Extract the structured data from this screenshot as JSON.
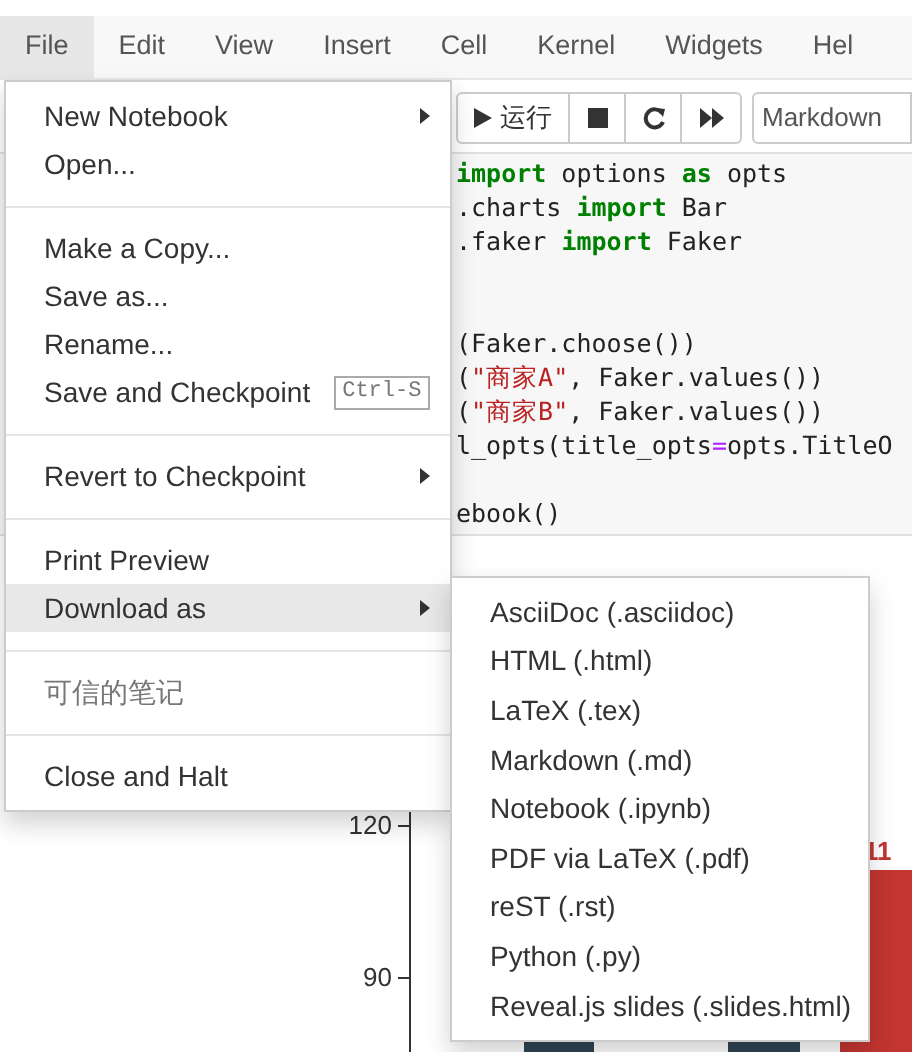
{
  "menu_bar": [
    {
      "label": "File",
      "selected": true
    },
    {
      "label": "Edit",
      "selected": false
    },
    {
      "label": "View",
      "selected": false
    },
    {
      "label": "Insert",
      "selected": false
    },
    {
      "label": "Cell",
      "selected": false
    },
    {
      "label": "Kernel",
      "selected": false
    },
    {
      "label": "Widgets",
      "selected": false
    },
    {
      "label": "Hel",
      "selected": false
    }
  ],
  "toolbar": {
    "run_label": "运行",
    "cell_type": "Markdown"
  },
  "code_lines": [
    [
      {
        "kind": "kw",
        "text": "import"
      },
      {
        "kind": "plain",
        "text": " options "
      },
      {
        "kind": "kw",
        "text": "as"
      },
      {
        "kind": "plain",
        "text": " opts"
      }
    ],
    [
      {
        "kind": "plain",
        "text": ".charts "
      },
      {
        "kind": "kw",
        "text": "import"
      },
      {
        "kind": "plain",
        "text": " Bar"
      }
    ],
    [
      {
        "kind": "plain",
        "text": ".faker "
      },
      {
        "kind": "kw",
        "text": "import"
      },
      {
        "kind": "plain",
        "text": " Faker"
      }
    ],
    [
      {
        "kind": "plain",
        "text": "(Faker.choose())"
      }
    ],
    [
      {
        "kind": "plain",
        "text": "("
      },
      {
        "kind": "str",
        "text": "\"商家A\""
      },
      {
        "kind": "plain",
        "text": ", Faker.values())"
      }
    ],
    [
      {
        "kind": "plain",
        "text": "("
      },
      {
        "kind": "str",
        "text": "\"商家B\""
      },
      {
        "kind": "plain",
        "text": ", Faker.values())"
      }
    ],
    [
      {
        "kind": "plain",
        "text": "l_opts(title_opts"
      },
      {
        "kind": "op",
        "text": "="
      },
      {
        "kind": "plain",
        "text": "opts.TitleO"
      }
    ],
    [
      {
        "kind": "plain",
        "text": "ebook()"
      }
    ]
  ],
  "chart": {
    "yticks": [
      "120",
      "90"
    ],
    "bar_label": "11"
  },
  "file_menu": [
    {
      "kind": "item",
      "label": "New Notebook",
      "submenu": true,
      "selected": false,
      "disabled": false
    },
    {
      "kind": "item",
      "label": "Open...",
      "submenu": false,
      "selected": false,
      "disabled": false
    },
    {
      "kind": "divider"
    },
    {
      "kind": "item",
      "label": "Make a Copy...",
      "submenu": false,
      "selected": false,
      "disabled": false
    },
    {
      "kind": "item",
      "label": "Save as...",
      "submenu": false,
      "selected": false,
      "disabled": false
    },
    {
      "kind": "item",
      "label": "Rename...",
      "submenu": false,
      "selected": false,
      "disabled": false
    },
    {
      "kind": "item",
      "label": "Save and Checkpoint",
      "shortcut": "Ctrl-S",
      "submenu": false,
      "selected": false,
      "disabled": false
    },
    {
      "kind": "divider"
    },
    {
      "kind": "item",
      "label": "Revert to Checkpoint",
      "submenu": true,
      "selected": false,
      "disabled": false
    },
    {
      "kind": "divider"
    },
    {
      "kind": "item",
      "label": "Print Preview",
      "submenu": false,
      "selected": false,
      "disabled": false
    },
    {
      "kind": "item",
      "label": "Download as",
      "submenu": true,
      "selected": true,
      "disabled": false
    },
    {
      "kind": "divider"
    },
    {
      "kind": "item",
      "label": "可信的笔记",
      "submenu": false,
      "selected": false,
      "disabled": true
    },
    {
      "kind": "divider"
    },
    {
      "kind": "item",
      "label": "Close and Halt",
      "submenu": false,
      "selected": false,
      "disabled": false
    }
  ],
  "download_menu": [
    "AsciiDoc (.asciidoc)",
    "HTML (.html)",
    "LaTeX (.tex)",
    "Markdown (.md)",
    "Notebook (.ipynb)",
    "PDF via LaTeX (.pdf)",
    "reST (.rst)",
    "Python (.py)",
    "Reveal.js slides (.slides.html)"
  ]
}
